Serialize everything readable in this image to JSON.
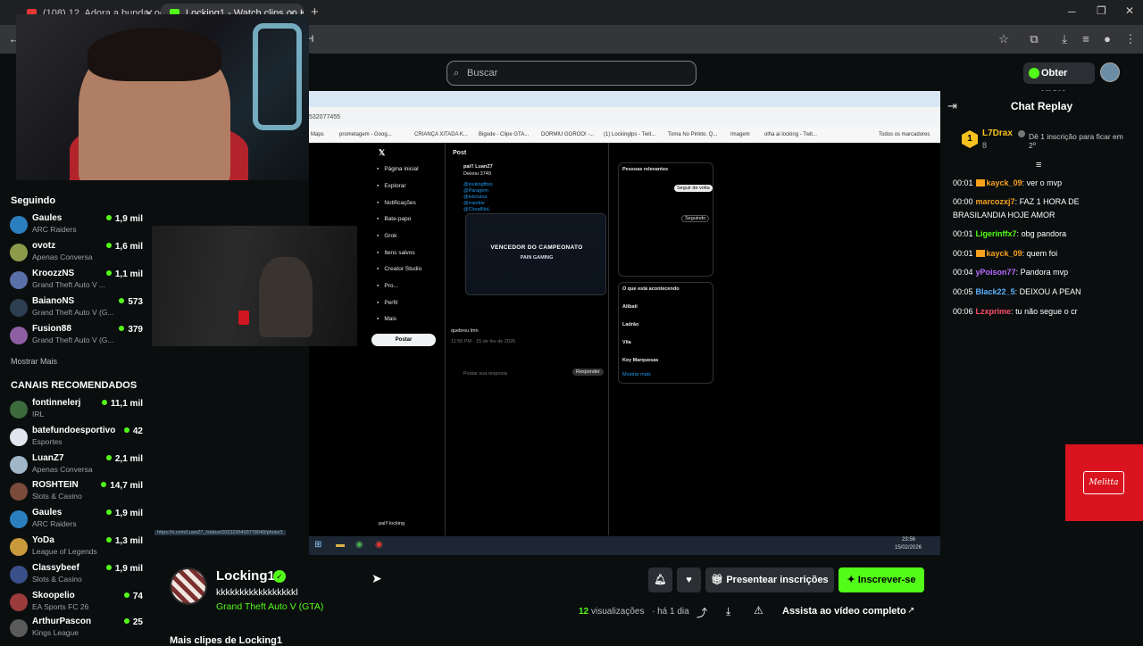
{
  "tabs": [
    {
      "title": "(108) 12. Adora a bunda, odeia...",
      "favicon_color": "#e53935"
    },
    {
      "title": "Locking1 - Watch clips on K...",
      "favicon_color": "#53fc18"
    }
  ],
  "address_fragment": "3KH",
  "search": {
    "placeholder": "Buscar"
  },
  "header": {
    "kicks_label": "Obter KICKs"
  },
  "sidebar": {
    "following_title": "Seguindo",
    "following": [
      {
        "name": "Gaules",
        "category": "ARC Raiders",
        "viewers": "1,9 mil",
        "avatar_color": "#2b7fbf"
      },
      {
        "name": "ovotz",
        "category": "Apenas Conversa",
        "viewers": "1,6 mil",
        "avatar_color": "#8c9a4a"
      },
      {
        "name": "KroozzNS",
        "category": "Grand Theft Auto V ...",
        "viewers": "1,1 mil",
        "avatar_color": "#5b6fa8"
      },
      {
        "name": "BaianoNS",
        "category": "Grand Theft Auto V (G...",
        "viewers": "573",
        "avatar_color": "#2c3e50"
      },
      {
        "name": "Fusion88",
        "category": "Grand Theft Auto V (G...",
        "viewers": "379",
        "avatar_color": "#8e5ea2"
      }
    ],
    "show_more": "Mostrar Mais",
    "recommended_title": "CANAIS RECOMENDADOS",
    "recommended": [
      {
        "name": "fontinnelerj",
        "category": "IRL",
        "viewers": "11,1 mil",
        "avatar_color": "#3d6b3d"
      },
      {
        "name": "batefundoesportivo",
        "category": "Esportes",
        "viewers": "42",
        "avatar_color": "#dfe6ee"
      },
      {
        "name": "LuanZ7",
        "category": "Apenas Conversa",
        "viewers": "2,1 mil",
        "avatar_color": "#9fb7c9"
      },
      {
        "name": "ROSHTEIN",
        "category": "Slots & Casino",
        "viewers": "14,7 mil",
        "avatar_color": "#7a4a3a"
      },
      {
        "name": "Gaules",
        "category": "ARC Raiders",
        "viewers": "1,9 mil",
        "avatar_color": "#2b7fbf"
      },
      {
        "name": "YoDa",
        "category": "League of Legends",
        "viewers": "1,3 mil",
        "avatar_color": "#c89a3c"
      },
      {
        "name": "Classybeef",
        "category": "Slots & Casino",
        "viewers": "1,9 mil",
        "avatar_color": "#3b4f8a"
      },
      {
        "name": "Skoopelio",
        "category": "EA Sports FC 26",
        "viewers": "74",
        "avatar_color": "#9b3b3b"
      },
      {
        "name": "ArthurPascon",
        "category": "Kings League",
        "viewers": "25",
        "avatar_color": "#5a5a5a"
      }
    ]
  },
  "screen": {
    "url": "532077455",
    "bookmarks": [
      "Maps",
      "prometagem - Goog...",
      "CRIANÇA XITADA K...",
      "Bigode - Clipe GTA...",
      "DORMIU GOROO! -...",
      "(1) Lockinglps - Twit...",
      "Toma No Pinkto. Q...",
      "Imagem",
      "olha ai locking - Twit...",
      "Todos os marcadores"
    ],
    "nav": [
      "Página inicial",
      "Explorar",
      "Notificações",
      "Bate-papo",
      "Grok",
      "Itens salvos",
      "Creator Studio",
      "Pro...",
      "Perfil",
      "Mais"
    ],
    "post_button": "Postar",
    "post_header": "Post",
    "tweet_author": "pai!! LuanZ7",
    "tweet_text": "Deixou 3749",
    "tweet_tags": [
      "@lockingfbss",
      "@Paragem",
      "@txtorvina",
      "@rranibis",
      "@CloudNoL"
    ],
    "image_title": "VENCEDOR DO CAMPEONATO",
    "image_sub": "PAIN GAMING",
    "reply_text": "quebrou lmn",
    "reply_date": "11:55 PM · 15 de fev de 2026",
    "reply_placeholder": "Postar sua resposta",
    "reply_button": "Responder",
    "relevant_title": "Pessoas relevantes",
    "happening_title": "O que está acontecendo",
    "follow_button": "Seguir de volta",
    "following_button": "Seguindo",
    "trends": [
      "Alibati",
      "Ladrão",
      "Vila",
      "Key Marquesas"
    ],
    "show_more": "Mostrar mais",
    "account_name": "pai!! locking",
    "clock_time": "23:56",
    "clock_date": "15/02/2026",
    "status_link": "https://x.com/LuanZ7_/status/2023295403778049/photo/1"
  },
  "chat": {
    "title": "Chat Replay",
    "top_gifter": {
      "name": "L7Drax",
      "rank": "1",
      "count": "8",
      "cta": "Dê 1 inscrição para ficar em 2º"
    },
    "messages": [
      {
        "time": "00:01",
        "user": "kayck_09",
        "text": "ver o mvp",
        "color": "#f6a21e",
        "badge": true
      },
      {
        "time": "00:00",
        "user": "marcozxj7",
        "text": "FAZ 1 HORA DE BRASILANDIA HOJE AMOR",
        "color": "#f6a21e",
        "badge": false
      },
      {
        "time": "00:01",
        "user": "Ligerinffx7",
        "text": "obg pandora",
        "color": "#53fc18",
        "badge": false
      },
      {
        "time": "00:01",
        "user": "kayck_09",
        "text": "quem foi",
        "color": "#f6a21e",
        "badge": true
      },
      {
        "time": "00:04",
        "user": "yPoison77",
        "text": "Pandora mvp",
        "color": "#b46bff",
        "badge": false
      },
      {
        "time": "00:05",
        "user": "Black22_5",
        "text": "DEIXOU A PEAN",
        "color": "#5ab4ff",
        "badge": false
      },
      {
        "time": "00:06",
        "user": "Lzxprime",
        "text": "tu não segue o cr",
        "color": "#ff4d6b",
        "badge": false
      }
    ]
  },
  "ad": {
    "brand": "Melitta"
  },
  "clip": {
    "channel": "Locking1",
    "title": "kkkkkkkkkkkkkkkkkl",
    "category": "Grand Theft Auto V (GTA)",
    "views_count": "12",
    "views_label": "visualizações",
    "ago": "· há 1 dia",
    "gift_button": "Presentear inscrições",
    "subscribe_button": "Inscrever-se",
    "watch_full": "Assista ao vídeo completo",
    "more_clips": "Mais clipes de Locking1"
  },
  "colors": {
    "accent": "#53fc18",
    "ad_red": "#d9141e"
  }
}
